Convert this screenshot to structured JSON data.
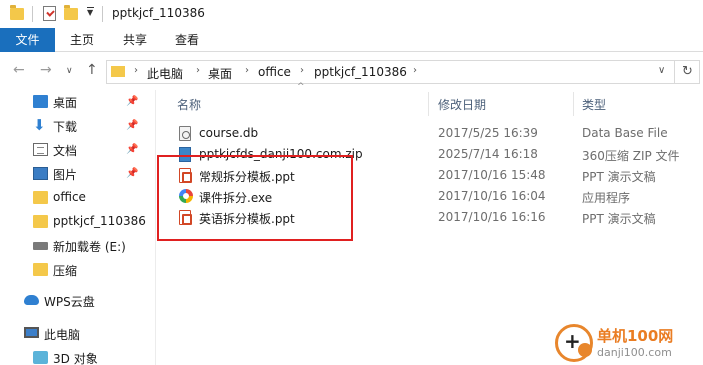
{
  "window": {
    "title": "pptkjcf_110386"
  },
  "ribbon": {
    "tabs": [
      {
        "label": "文件",
        "active": true
      },
      {
        "label": "主页",
        "active": false
      },
      {
        "label": "共享",
        "active": false
      },
      {
        "label": "查看",
        "active": false
      }
    ]
  },
  "address": {
    "breadcrumbs": [
      "此电脑",
      "桌面",
      "office",
      "pptkjcf_110386"
    ]
  },
  "sidebar": {
    "items": [
      {
        "label": "桌面",
        "icon": "desktop-icon",
        "pinned": true
      },
      {
        "label": "下载",
        "icon": "download-icon",
        "pinned": true
      },
      {
        "label": "文档",
        "icon": "document-icon",
        "pinned": true
      },
      {
        "label": "图片",
        "icon": "pictures-icon",
        "pinned": true
      },
      {
        "label": "office",
        "icon": "folder-icon",
        "pinned": false
      },
      {
        "label": "pptkjcf_110386",
        "icon": "folder-icon",
        "pinned": false
      },
      {
        "label": "新加载卷 (E:)",
        "icon": "drive-icon",
        "pinned": false
      },
      {
        "label": "压缩",
        "icon": "folder-icon",
        "pinned": false
      },
      {
        "label": "WPS云盘",
        "icon": "cloud-icon",
        "pinned": false
      },
      {
        "label": "此电脑",
        "icon": "computer-icon",
        "pinned": false
      },
      {
        "label": "3D 对象",
        "icon": "3d-objects-icon",
        "pinned": false
      }
    ]
  },
  "columns": {
    "name": "名称",
    "date": "修改日期",
    "type": "类型"
  },
  "files": [
    {
      "name": "course.db",
      "date": "2017/5/25 16:39",
      "type": "Data Base File",
      "icon": "database-file-icon"
    },
    {
      "name": "pptkjcfds_danji100.com.zip",
      "date": "2025/7/14 16:18",
      "type": "360压缩 ZIP 文件",
      "icon": "zip-file-icon"
    },
    {
      "name": "常规拆分模板.ppt",
      "date": "2017/10/16 15:48",
      "type": "PPT 演示文稿",
      "icon": "ppt-file-icon"
    },
    {
      "name": "课件拆分.exe",
      "date": "2017/10/16 16:04",
      "type": "应用程序",
      "icon": "exe-file-icon"
    },
    {
      "name": "英语拆分模板.ppt",
      "date": "2017/10/16 16:16",
      "type": "PPT 演示文稿",
      "icon": "ppt-file-icon"
    }
  ],
  "watermark": {
    "name": "单机100网",
    "url": "danji100.com"
  },
  "colors": {
    "file_tab": "#1a6fbd",
    "highlight": "#e02020",
    "watermark": "#ea7d23"
  }
}
